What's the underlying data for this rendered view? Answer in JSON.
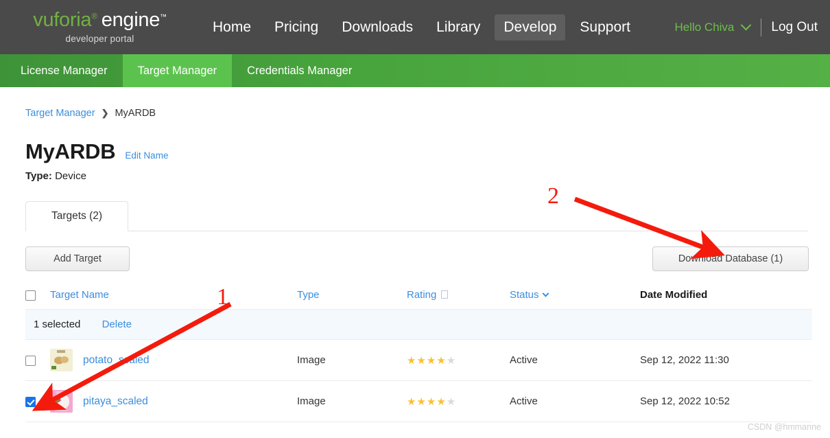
{
  "header": {
    "logo": {
      "brand": "vuforia",
      "product": "engine",
      "registered": "®",
      "tm": "™",
      "subtitle": "developer portal"
    },
    "nav": [
      {
        "label": "Home",
        "active": false
      },
      {
        "label": "Pricing",
        "active": false
      },
      {
        "label": "Downloads",
        "active": false
      },
      {
        "label": "Library",
        "active": false
      },
      {
        "label": "Develop",
        "active": true
      },
      {
        "label": "Support",
        "active": false
      }
    ],
    "user_greeting": "Hello Chiva",
    "logout_label": "Log Out"
  },
  "subnav": [
    {
      "label": "License Manager",
      "active": false
    },
    {
      "label": "Target Manager",
      "active": true
    },
    {
      "label": "Credentials Manager",
      "active": false
    }
  ],
  "breadcrumb": {
    "root": "Target Manager",
    "separator": "❯",
    "current": "MyARDB"
  },
  "page": {
    "title": "MyARDB",
    "edit_name_label": "Edit Name",
    "type_label": "Type:",
    "type_value": "Device"
  },
  "tabs": [
    {
      "label": "Targets (2)",
      "active": true
    }
  ],
  "toolbar": {
    "add_target_label": "Add Target",
    "download_database_label": "Download Database (1)"
  },
  "table": {
    "headers": {
      "target_name": "Target Name",
      "type": "Type",
      "rating": "Rating",
      "status": "Status",
      "date_modified": "Date Modified"
    },
    "selection_bar": {
      "count_label": "1 selected",
      "delete_label": "Delete"
    },
    "rows": [
      {
        "checked": false,
        "thumb_class": "potato",
        "thumb_glyph": "🥔",
        "name": "potato_scaled",
        "type": "Image",
        "rating": 4,
        "rating_max": 5,
        "status": "Active",
        "date_modified": "Sep 12, 2022 11:30"
      },
      {
        "checked": true,
        "thumb_class": "pitaya",
        "thumb_glyph": "🍎",
        "name": "pitaya_scaled",
        "type": "Image",
        "rating": 4,
        "rating_max": 5,
        "status": "Active",
        "date_modified": "Sep 12, 2022 10:52"
      }
    ]
  },
  "annotations": [
    {
      "label": "1",
      "color": "#f41b0c"
    },
    {
      "label": "2",
      "color": "#f41b0c"
    }
  ],
  "watermark": "CSDN @hmmanne",
  "colors": {
    "header_bg": "#4a4a4a",
    "subnav_green": "#47a33c",
    "subnav_active_green": "#5cc24e",
    "link_blue": "#3b8ede",
    "brand_green": "#72b043",
    "star_gold": "#fcc02e",
    "annotation_red": "#f41b0c"
  }
}
